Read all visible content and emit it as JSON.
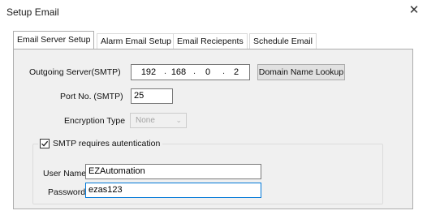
{
  "window": {
    "title": "Setup Email",
    "close_glyph": "✕"
  },
  "tabs": [
    {
      "label": "Email Server Setup",
      "active": true
    },
    {
      "label": "Alarm Email Setup",
      "active": false
    },
    {
      "label": "Email Reciepents",
      "active": false
    },
    {
      "label": "Schedule Email",
      "active": false
    }
  ],
  "server": {
    "outgoing_label": "Outgoing Server(SMTP)",
    "ip": [
      "192",
      "168",
      "0",
      "2"
    ],
    "ip_separator": ".",
    "lookup_button": "Domain Name Lookup",
    "port_label": "Port No. (SMTP)",
    "port_value": "25",
    "encryption_label": "Encryption Type",
    "encryption_value": "None",
    "encryption_caret": "⌄"
  },
  "auth": {
    "checkbox_label": "SMTP requires autentication",
    "checked": true,
    "username_label": "User Name",
    "username_value": "EZAutomation",
    "password_label": "Password",
    "password_value": "ezas123"
  },
  "colors": {
    "panel": "#f0f0f0",
    "focus_border": "#0078d7",
    "button": "#e1e1e1"
  },
  "icons": {
    "close": "close-icon",
    "check": "checkmark-icon",
    "dropdown": "chevron-down-icon"
  }
}
